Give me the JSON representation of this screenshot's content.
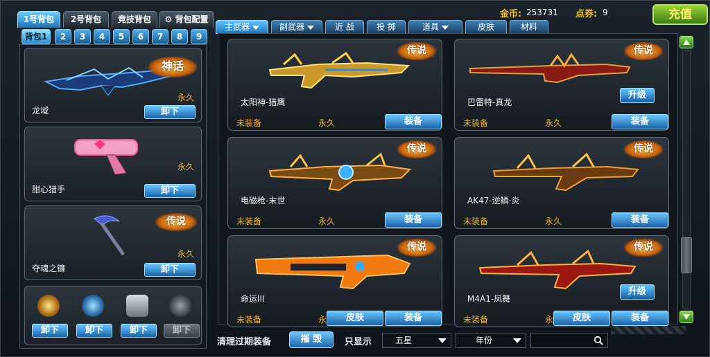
{
  "bag_tabs": [
    {
      "label": "1号背包",
      "active": true
    },
    {
      "label": "2号背包",
      "active": false
    },
    {
      "label": "竞技背包",
      "active": false
    }
  ],
  "bag_config": {
    "label": "背包配置",
    "icon": "gear-icon"
  },
  "sub_bags": [
    "背包1",
    "2",
    "3",
    "4",
    "5",
    "6",
    "7",
    "8",
    "9"
  ],
  "left_slots": [
    {
      "name": "龙域",
      "duration": "永久",
      "button": "卸下",
      "badge": "神话"
    },
    {
      "name": "甜心猎手",
      "duration": "永久",
      "button": "卸下",
      "badge": ""
    },
    {
      "name": "夺魂之镰",
      "duration": "永久",
      "button": "卸下",
      "badge": "传说"
    }
  ],
  "items_strip": [
    {
      "icon": "grenade-gold-icon",
      "button": "卸下",
      "enabled": true
    },
    {
      "icon": "drone-icon",
      "button": "卸下",
      "enabled": true
    },
    {
      "icon": "smoke-grenade-icon",
      "button": "卸下",
      "enabled": true
    },
    {
      "icon": "frag-grenade-icon",
      "button": "卸下",
      "enabled": false
    }
  ],
  "header": {
    "coin_label": "金币:",
    "coin_value": "253731",
    "coupon_label": "点券:",
    "coupon_value": "9",
    "recharge": "充值"
  },
  "categories": [
    {
      "label": "主武器",
      "active": true,
      "dropdown": true
    },
    {
      "label": "副武器",
      "active": false,
      "dropdown": true
    },
    {
      "label": "近 战",
      "active": false,
      "dropdown": false
    },
    {
      "label": "投 掷",
      "active": false,
      "dropdown": false
    },
    {
      "label": "道具",
      "active": false,
      "dropdown": true
    },
    {
      "label": "皮肤",
      "active": false,
      "dropdown": false
    },
    {
      "label": "材料",
      "active": false,
      "dropdown": false
    }
  ],
  "weapons": [
    {
      "name": "太阳神-猎鹰",
      "status": "未装备",
      "duration": "永久",
      "badge": "传说",
      "equip": "装备",
      "skin": "",
      "upgrade": ""
    },
    {
      "name": "巴雷特-真龙",
      "status": "未装备",
      "duration": "永久",
      "badge": "传说",
      "equip": "装备",
      "skin": "",
      "upgrade": "升级"
    },
    {
      "name": "电磁枪-末世",
      "status": "未装备",
      "duration": "永久",
      "badge": "传说",
      "equip": "装备",
      "skin": "",
      "upgrade": ""
    },
    {
      "name": "AK47-逆鳞·炎",
      "status": "未装备",
      "duration": "永久",
      "badge": "传说",
      "equip": "装备",
      "skin": "",
      "upgrade": ""
    },
    {
      "name": "命运III",
      "status": "未装备",
      "duration": "永久",
      "badge": "传说",
      "equip": "装备",
      "skin": "皮肤",
      "upgrade": ""
    },
    {
      "name": "M4A1-凤舞",
      "status": "未装备",
      "duration": "永久",
      "badge": "传说",
      "equip": "装备",
      "skin": "皮肤",
      "upgrade": "升级"
    }
  ],
  "bottom": {
    "clear_label": "清理过期装备",
    "destroy": "摧 毁",
    "show_only": "只显示",
    "filter_star": "五星",
    "filter_year": "年份",
    "search_icon": "search-icon"
  },
  "colors": {
    "accent": "#1e78c0",
    "gold": "#e9b53a",
    "recharge": "#3b7c12"
  }
}
